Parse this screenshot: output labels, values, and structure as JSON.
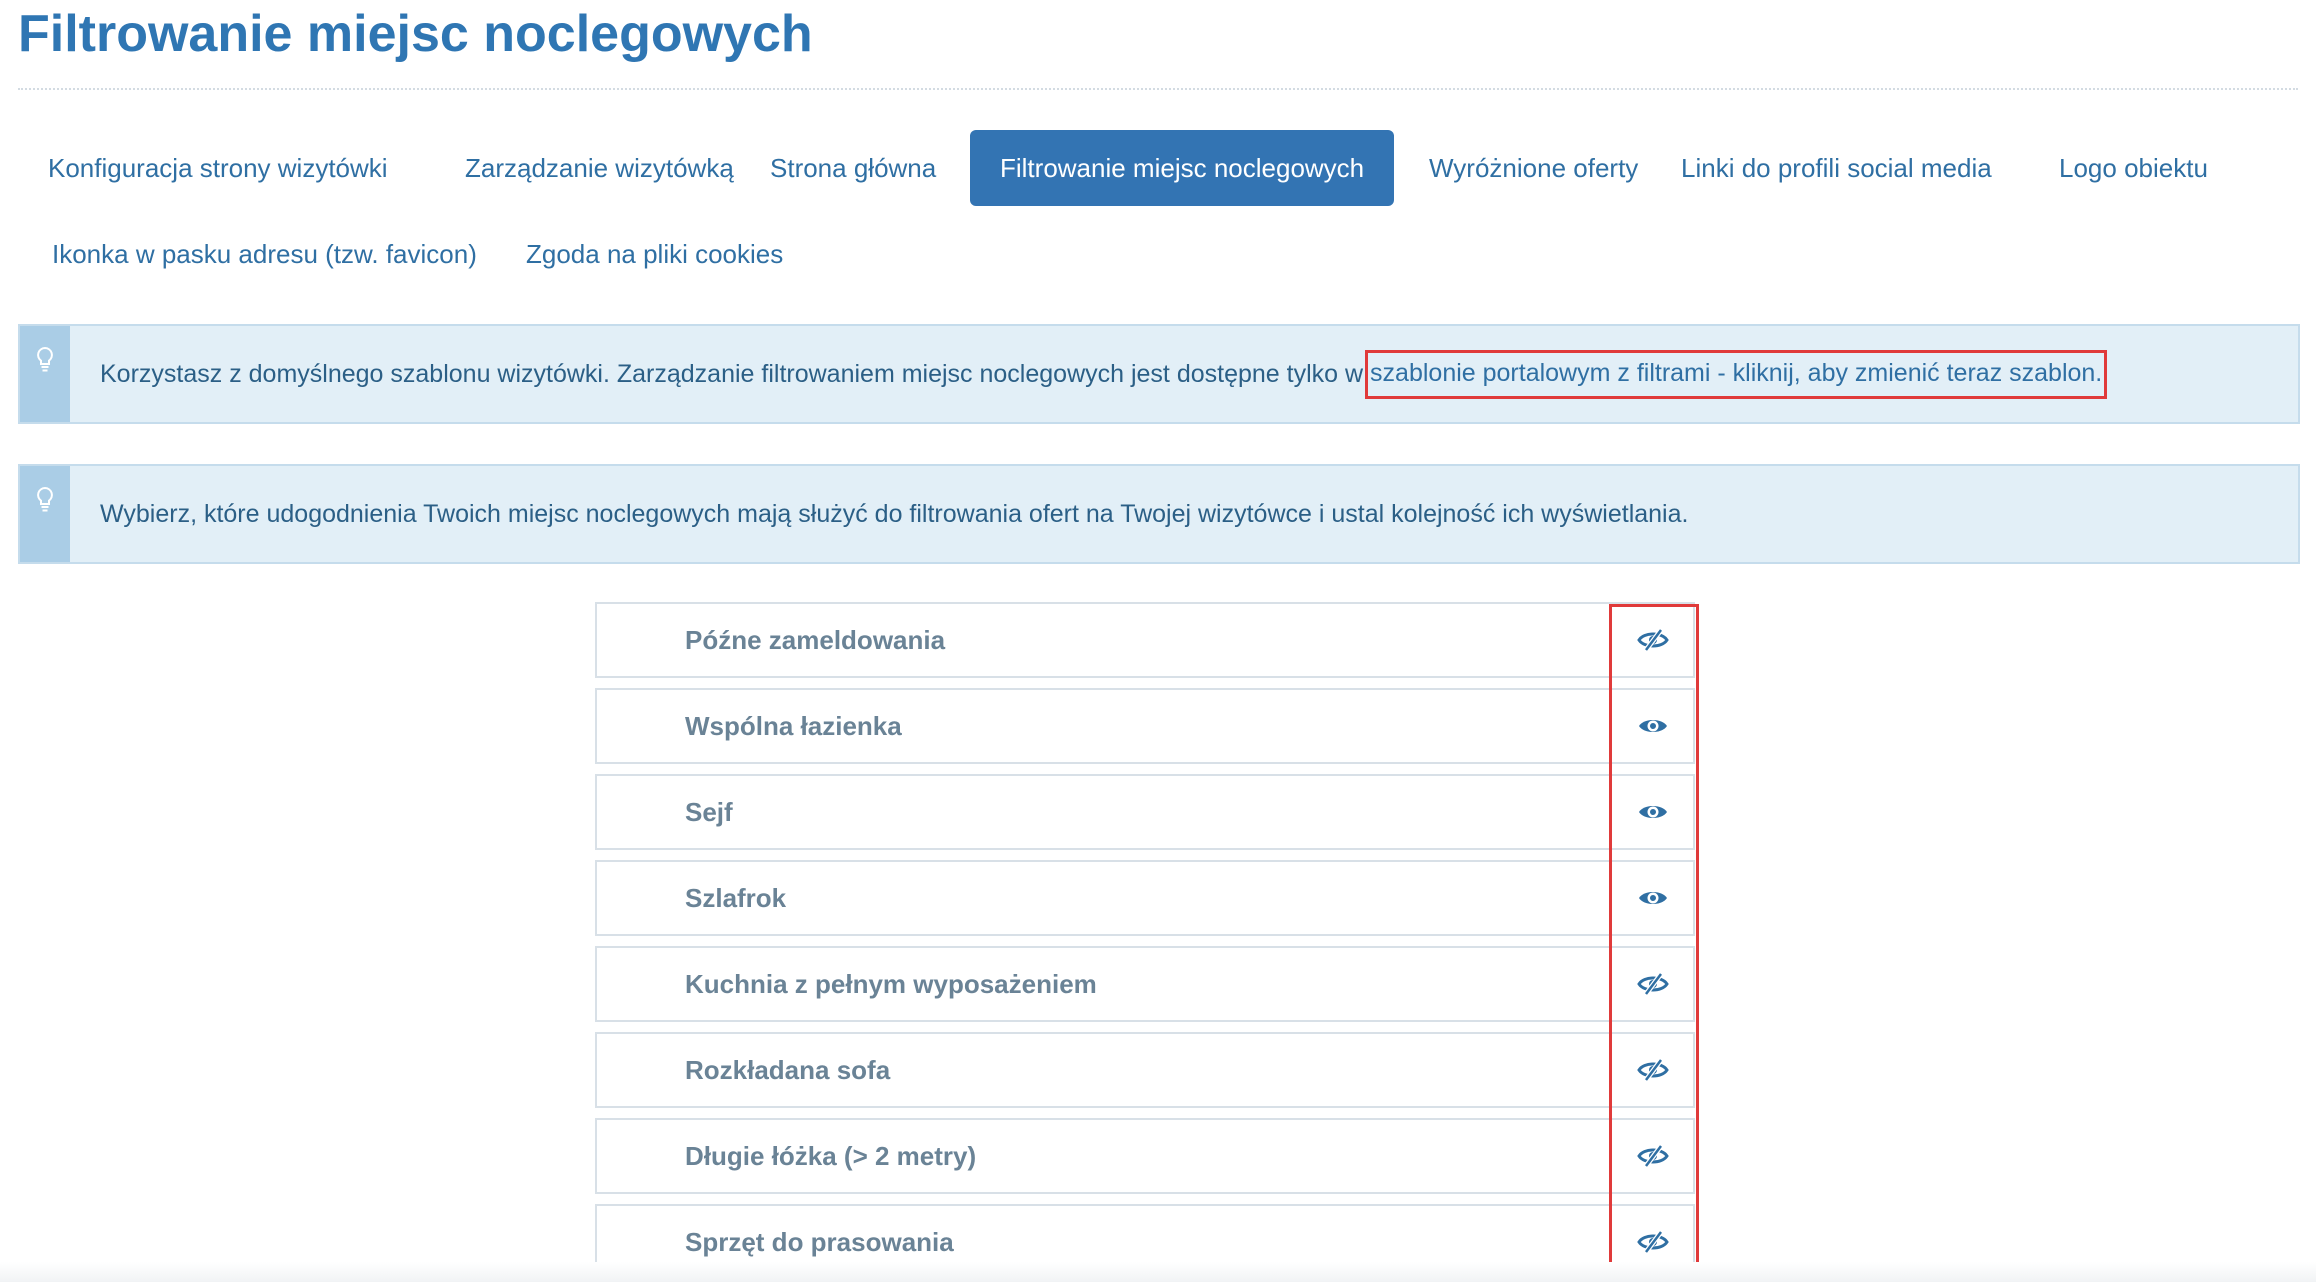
{
  "page": {
    "title": "Filtrowanie miejsc noclegowych"
  },
  "tabs": [
    {
      "label": "Konfiguracja strony wizytówki",
      "active": false
    },
    {
      "label": "Zarządzanie wizytówką",
      "active": false
    },
    {
      "label": "Strona główna",
      "active": false
    },
    {
      "label": "Filtrowanie miejsc noclegowych",
      "active": true
    },
    {
      "label": "Wyróżnione oferty",
      "active": false
    },
    {
      "label": "Linki do profili social media",
      "active": false
    },
    {
      "label": "Logo obiektu",
      "active": false
    },
    {
      "label": "Ikonka w pasku adresu (tzw. favicon)",
      "active": false
    },
    {
      "label": "Zgoda na pliki cookies",
      "active": false
    }
  ],
  "notices": {
    "template": {
      "icon": "lightbulb-icon",
      "text": "Korzystasz z domyślnego szablonu wizytówki. Zarządzanie filtrowaniem miejsc noclegowych jest dostępne tylko w ",
      "link": "szablonie portalowym z filtrami - kliknij, aby zmienić teraz szablon."
    },
    "instructions": {
      "icon": "lightbulb-icon",
      "text": "Wybierz, które udogodnienia Twoich miejsc noclegowych mają służyć do filtrowania ofert na Twojej wizytówce i ustal kolejność ich wyświetlania."
    }
  },
  "filters": [
    {
      "label": "Późne zameldowania",
      "visible": false,
      "icon": "eye-slash-icon"
    },
    {
      "label": "Wspólna łazienka",
      "visible": true,
      "icon": "eye-icon"
    },
    {
      "label": "Sejf",
      "visible": true,
      "icon": "eye-icon"
    },
    {
      "label": "Szlafrok",
      "visible": true,
      "icon": "eye-icon"
    },
    {
      "label": "Kuchnia z pełnym wyposażeniem",
      "visible": false,
      "icon": "eye-slash-icon"
    },
    {
      "label": "Rozkładana sofa",
      "visible": false,
      "icon": "eye-slash-icon"
    },
    {
      "label": "Długie łóżka (> 2 metry)",
      "visible": false,
      "icon": "eye-slash-icon"
    },
    {
      "label": "Sprzęt do prasowania",
      "visible": false,
      "icon": "eye-slash-icon"
    }
  ],
  "colors": {
    "accent": "#3374b3",
    "title": "#2f76b3",
    "notice_background": "#e2eff7",
    "notice_strip": "#aacde6",
    "highlight": "#e03a3a",
    "filter_label": "#6a8396"
  }
}
